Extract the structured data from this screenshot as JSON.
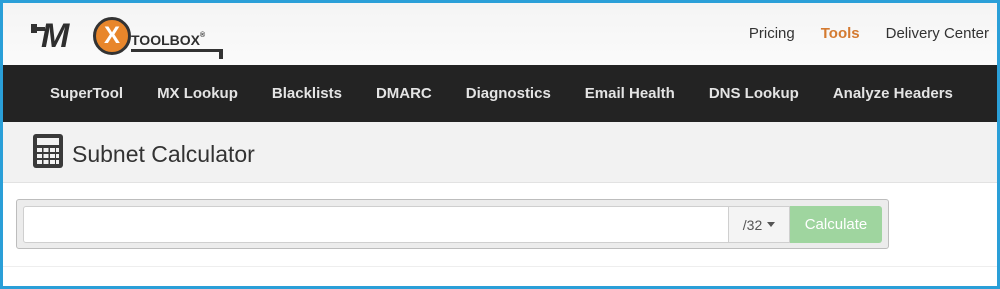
{
  "logo": {
    "mark_left": "M",
    "mark_x": "X",
    "wordmark": "TOOLBOX",
    "registered": "®"
  },
  "header": {
    "links": [
      {
        "label": "Pricing",
        "active": false
      },
      {
        "label": "Tools",
        "active": true
      },
      {
        "label": "Delivery Center",
        "active": false
      }
    ]
  },
  "nav": {
    "items": [
      "SuperTool",
      "MX Lookup",
      "Blacklists",
      "DMARC",
      "Diagnostics",
      "Email Health",
      "DNS Lookup",
      "Analyze Headers"
    ]
  },
  "page": {
    "title": "Subnet Calculator",
    "icon": "calculator-icon"
  },
  "form": {
    "ip_value": "",
    "ip_placeholder": "",
    "mask_selected": "/32",
    "submit_label": "Calculate"
  },
  "colors": {
    "frame_border": "#2a9fd8",
    "navbar_bg": "#232323",
    "accent_active": "#d47a30",
    "button_bg": "#9fd59f",
    "logo_orange": "#e8862b"
  }
}
